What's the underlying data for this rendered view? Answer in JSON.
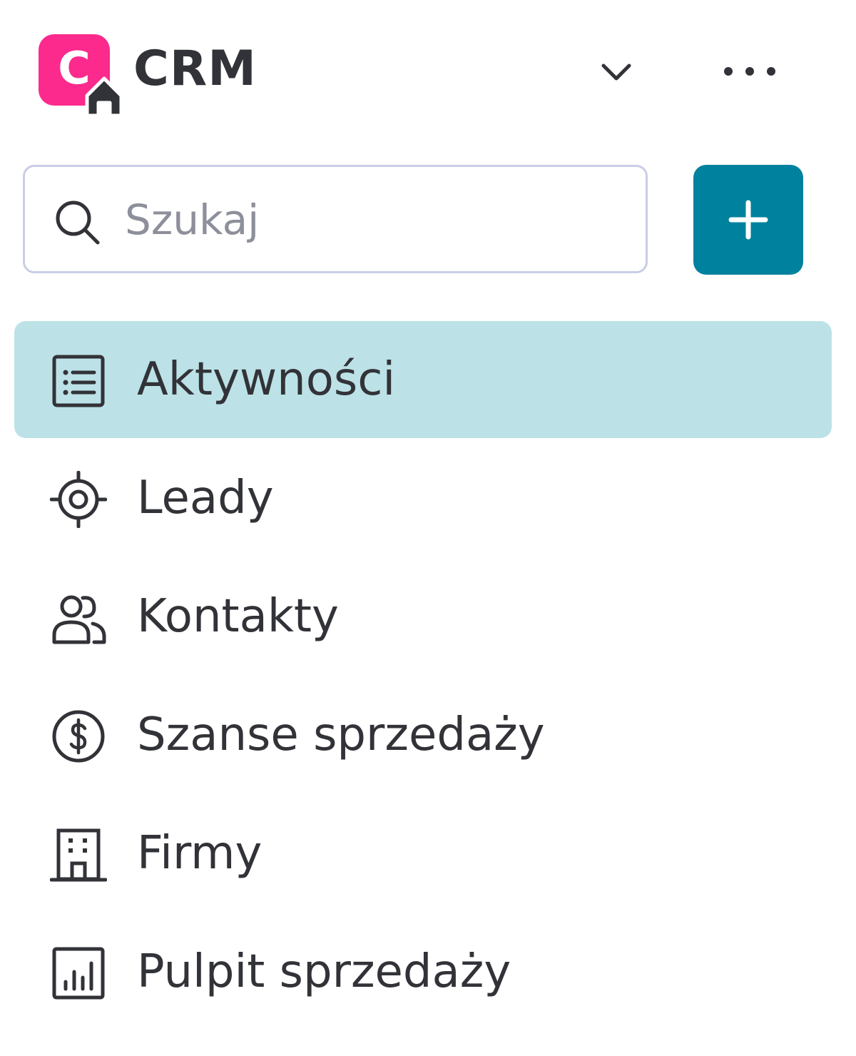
{
  "header": {
    "logo_letter": "C",
    "title": "CRM",
    "brand_color": "#fb2a8c",
    "dropdown_icon": "chevron-down-icon",
    "more_icon": "more-horizontal-icon"
  },
  "search": {
    "placeholder": "Szukaj",
    "value": "",
    "icon": "search-icon"
  },
  "add_button": {
    "icon": "plus-icon",
    "color": "#00819e"
  },
  "nav": {
    "active_color": "#bce2e7",
    "items": [
      {
        "label": "Aktywności",
        "icon": "list-icon",
        "active": true
      },
      {
        "label": "Leady",
        "icon": "target-icon",
        "active": false
      },
      {
        "label": "Kontakty",
        "icon": "users-icon",
        "active": false
      },
      {
        "label": "Szanse sprzedaży",
        "icon": "dollar-icon",
        "active": false
      },
      {
        "label": "Firmy",
        "icon": "building-icon",
        "active": false
      },
      {
        "label": "Pulpit sprzedaży",
        "icon": "chart-icon",
        "active": false
      }
    ]
  }
}
